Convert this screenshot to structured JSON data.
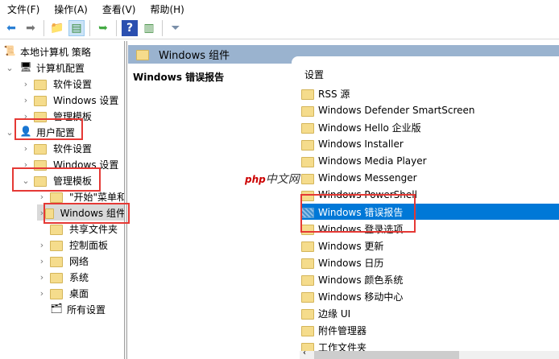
{
  "menu": [
    "文件(F)",
    "操作(A)",
    "查看(V)",
    "帮助(H)"
  ],
  "toolbar": {
    "icons": [
      "back-arrow-icon",
      "forward-arrow-icon",
      "up-folder-icon",
      "show-hide-tree-icon",
      "export-list-icon",
      "help-icon",
      "show-action-pane-icon",
      "filter-icon"
    ]
  },
  "tree": [
    {
      "label": "本地计算机 策略"
    },
    {
      "label": "计算机配置"
    },
    {
      "label": "软件设置"
    },
    {
      "label": "Windows 设置"
    },
    {
      "label": "管理模板"
    },
    {
      "label": "用户配置"
    },
    {
      "label": "软件设置"
    },
    {
      "label": "Windows 设置"
    },
    {
      "label": "管理模板"
    },
    {
      "label": "\"开始\"菜单和"
    },
    {
      "label": "Windows 组件"
    },
    {
      "label": "共享文件夹"
    },
    {
      "label": "控制面板"
    },
    {
      "label": "网络"
    },
    {
      "label": "系统"
    },
    {
      "label": "桌面"
    },
    {
      "label": "所有设置"
    }
  ],
  "header": {
    "title": "Windows 组件"
  },
  "description": {
    "title": "Windows 错误报告"
  },
  "list": {
    "column": "设置",
    "items": [
      "RSS 源",
      "Windows Defender SmartScreen",
      "Windows Hello 企业版",
      "Windows Installer",
      "Windows Media Player",
      "Windows Messenger",
      "Windows PowerShell",
      "Windows 错误报告",
      "Windows 登录选项",
      "Windows 更新",
      "Windows 日历",
      "Windows 颜色系统",
      "Windows 移动中心",
      "边缘 UI",
      "附件管理器",
      "工作文件夹"
    ],
    "selected": 7
  },
  "watermark": {
    "brand": "php",
    "text": "中文网"
  },
  "colors": {
    "accent": "#0078d7",
    "highlight": "#e53935",
    "header": "#9ab3cf"
  }
}
